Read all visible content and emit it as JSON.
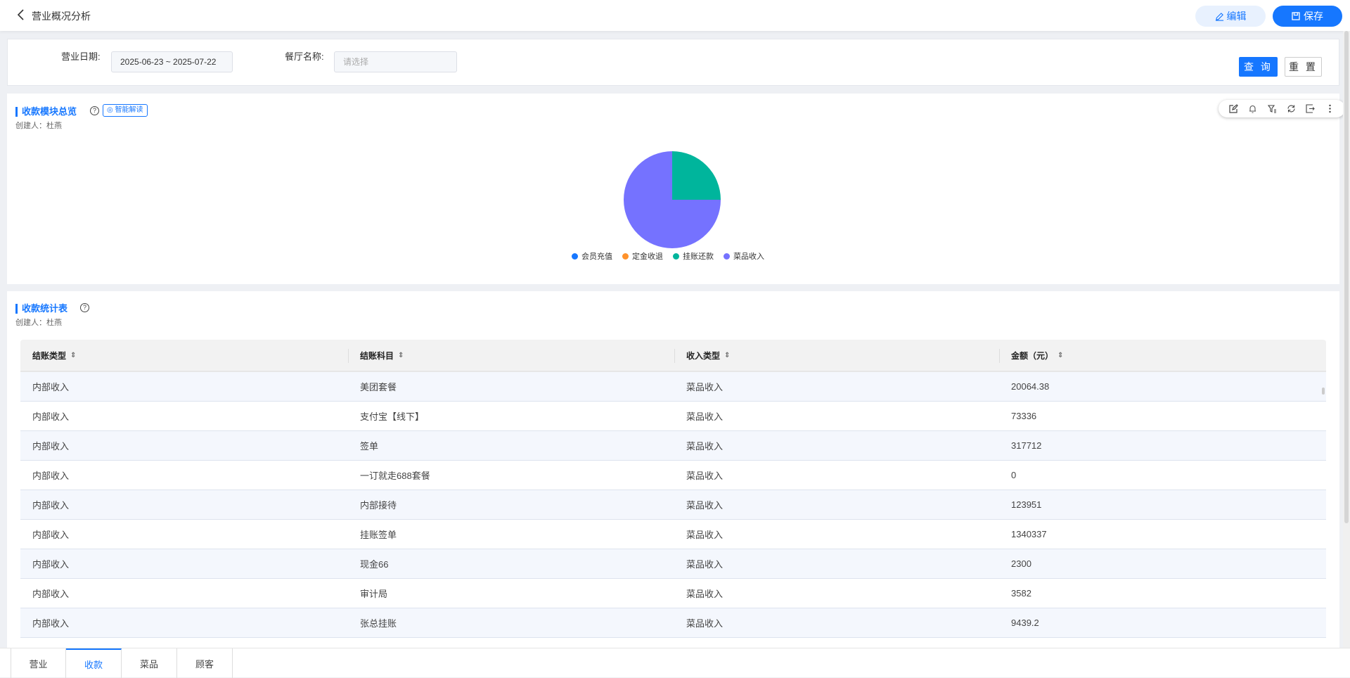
{
  "header": {
    "title": "营业概况分析",
    "edit_label": "编辑",
    "save_label": "保存"
  },
  "filter": {
    "date_label": "营业日期:",
    "date_value": "2025-06-23 ~ 2025-07-22",
    "restaurant_label": "餐厅名称:",
    "restaurant_placeholder": "请选择",
    "query_label": "查 询",
    "reset_label": "重 置"
  },
  "overview": {
    "title": "收款模块总览",
    "ai_label": "智能解读",
    "creator": "创建人：杜燕",
    "help": "?"
  },
  "chart_data": {
    "type": "pie",
    "title": "收款模块总览",
    "legend_position": "bottom",
    "categories": [
      "会员充值",
      "定金收退",
      "挂账还款",
      "菜品收入"
    ],
    "values": [
      0,
      0,
      25,
      75
    ],
    "colors": [
      "#1677ff",
      "#ff922b",
      "#00b59c",
      "#7572ff"
    ]
  },
  "table_section": {
    "title": "收款统计表",
    "creator": "创建人：杜燕",
    "help": "?"
  },
  "table": {
    "columns": [
      "结账类型",
      "结账科目",
      "收入类型",
      "金额（元）"
    ],
    "rows": [
      [
        "内部收入",
        "美团套餐",
        "菜品收入",
        "20064.38"
      ],
      [
        "内部收入",
        "支付宝【线下】",
        "菜品收入",
        "73336"
      ],
      [
        "内部收入",
        "签单",
        "菜品收入",
        "317712"
      ],
      [
        "内部收入",
        "一订就走688套餐",
        "菜品收入",
        "0"
      ],
      [
        "内部收入",
        "内部接待",
        "菜品收入",
        "123951"
      ],
      [
        "内部收入",
        "挂账签单",
        "菜品收入",
        "1340337"
      ],
      [
        "内部收入",
        "现金66",
        "菜品收入",
        "2300"
      ],
      [
        "内部收入",
        "审计局",
        "菜品收入",
        "3582"
      ],
      [
        "内部收入",
        "张总挂账",
        "菜品收入",
        "9439.2"
      ]
    ]
  },
  "tabs": [
    "营业",
    "收款",
    "菜品",
    "顾客"
  ],
  "active_tab": "收款"
}
